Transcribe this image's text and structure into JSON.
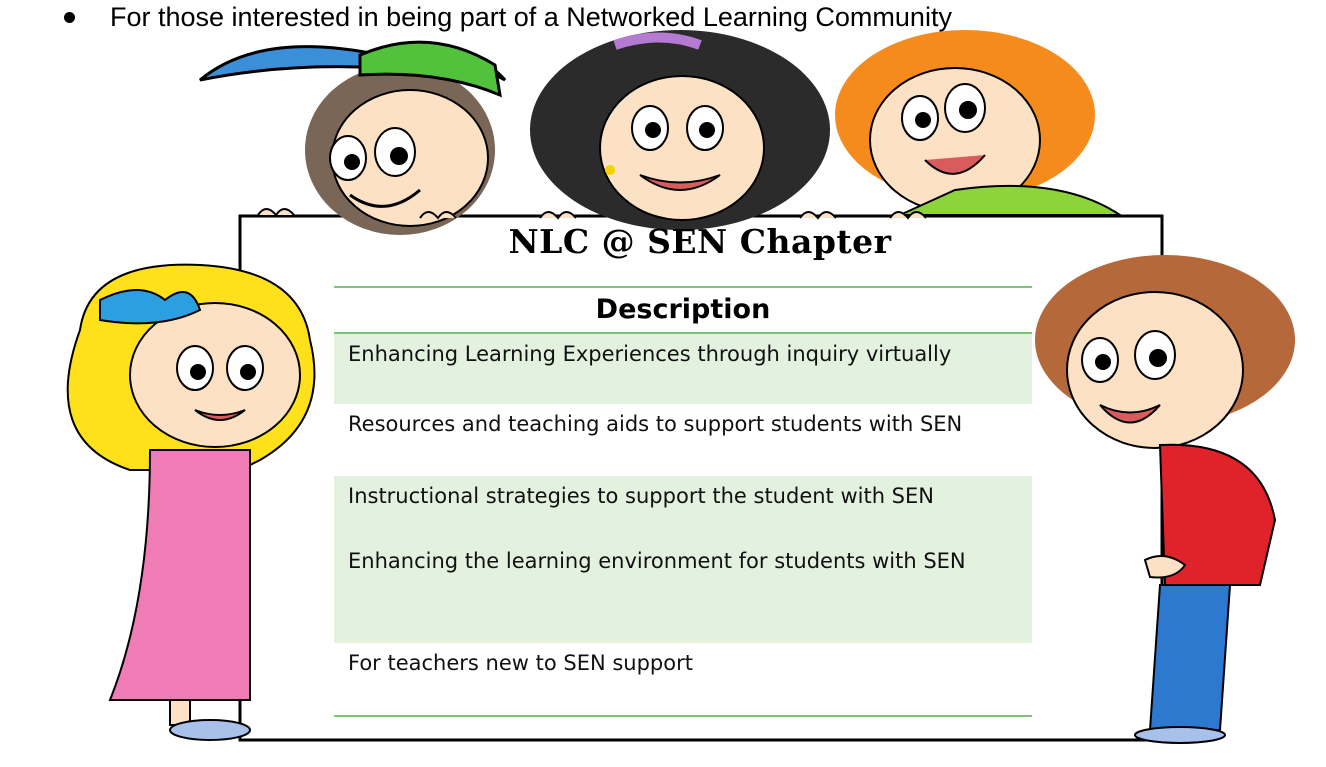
{
  "bullet": {
    "text": "For those interested in being part of a Networked Learning Community"
  },
  "board": {
    "title": "NLC @ SEN Chapter",
    "table_header": "Description",
    "rows": [
      "Enhancing Learning Experiences through inquiry virtually",
      "Resources and teaching aids to support students with SEN",
      "Instructional strategies to support the student with SEN",
      "Enhancing the learning environment for students with SEN",
      "For teachers new to SEN support"
    ]
  },
  "colors": {
    "row_shade": "#e3f1df",
    "rule": "#7cc576"
  }
}
